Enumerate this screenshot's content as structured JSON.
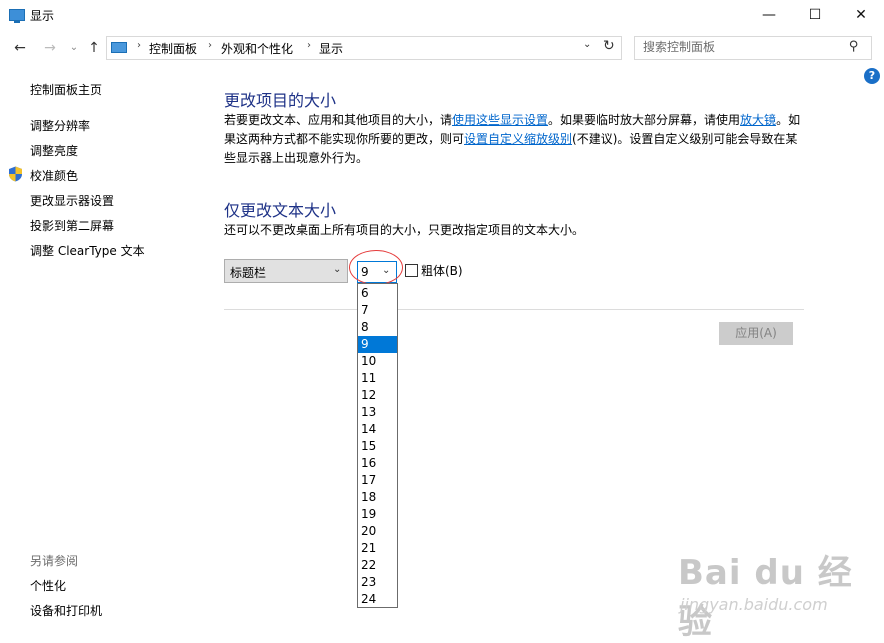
{
  "window": {
    "title": "显示",
    "minimize": "—",
    "maximize": "☐",
    "close": "✕"
  },
  "nav": {
    "back": "←",
    "forward": "→",
    "recent": "⌄",
    "up": "↑",
    "breadcrumb": [
      "控制面板",
      "外观和个性化",
      "显示"
    ],
    "separator": "›",
    "dropdown": "⌄",
    "refresh": "↻"
  },
  "search": {
    "placeholder": "搜索控制面板",
    "icon": "⚲"
  },
  "help": {
    "label": "?"
  },
  "sidebar": {
    "items": [
      {
        "label": "控制面板主页"
      },
      {
        "label": "调整分辨率"
      },
      {
        "label": "调整亮度"
      },
      {
        "label": "校准颜色"
      },
      {
        "label": "更改显示器设置"
      },
      {
        "label": "投影到第二屏幕"
      },
      {
        "label": "调整 ClearType 文本"
      }
    ],
    "see_also": {
      "heading": "另请参阅",
      "items": [
        {
          "label": "个性化"
        },
        {
          "label": "设备和打印机"
        }
      ]
    }
  },
  "main": {
    "section1": {
      "title": "更改项目的大小",
      "line1_pre": "若要更改文本、应用和其他项目的大小，请",
      "link_display_settings": "使用这些显示设置",
      "line1_mid": "。如果要临时放大部分屏幕，请使用",
      "link_magnifier": "放大镜",
      "line1_post": "。如",
      "line2_pre": "果这两种方式都不能实现你所要的更改，则可",
      "link_custom_scaling": "设置自定义缩放级别",
      "line2_post": "(不建议)。设置自定义级别可能会导致在某",
      "line3": "些显示器上出现意外行为。"
    },
    "section2": {
      "title": "仅更改文本大小",
      "description": "还可以不更改桌面上所有项目的大小，只更改指定项目的文本大小。",
      "item_select_value": "标题栏",
      "size_select_value": "9",
      "chevron": "⌄",
      "bold_label": "粗体(B)",
      "bold_checked": false,
      "size_options": [
        "6",
        "7",
        "8",
        "9",
        "10",
        "11",
        "12",
        "13",
        "14",
        "15",
        "16",
        "17",
        "18",
        "19",
        "20",
        "21",
        "22",
        "23",
        "24"
      ],
      "selected_size": "9"
    },
    "apply_label": "应用(A)"
  },
  "watermark": {
    "text": "Bai du 经验",
    "url": "jingyan.baidu.com"
  },
  "colors": {
    "heading": "#1e3287",
    "link": "#0066cc",
    "accent": "#0078d7",
    "highlight_ellipse": "#e53b3b"
  }
}
